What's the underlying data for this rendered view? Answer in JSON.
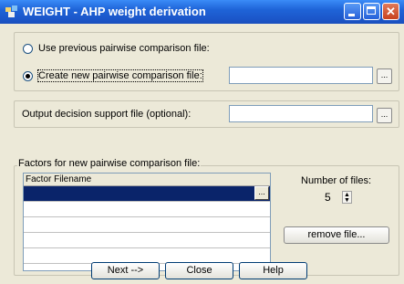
{
  "window": {
    "title": "WEIGHT - AHP weight derivation",
    "controls": {
      "minimize": "minimize-icon",
      "maximize": "maximize-icon",
      "close": "close-icon"
    }
  },
  "options": {
    "use_previous_label": "Use previous pairwise comparison file:",
    "use_previous_selected": false,
    "create_new_label": "Create new pairwise comparison file:",
    "create_new_selected": true,
    "create_new_value": "",
    "browse_label": "..."
  },
  "output": {
    "label": "Output decision support file (optional):",
    "value": "",
    "browse_label": "..."
  },
  "factors": {
    "group_label": "Factors for new pairwise comparison file:",
    "column_header": "Factor Filename",
    "row_browse_label": "...",
    "number_of_files_label": "Number of files:",
    "number_of_files": "5",
    "remove_button": "remove file..."
  },
  "buttons": {
    "next": "Next -->",
    "close": "Close",
    "help": "Help"
  }
}
